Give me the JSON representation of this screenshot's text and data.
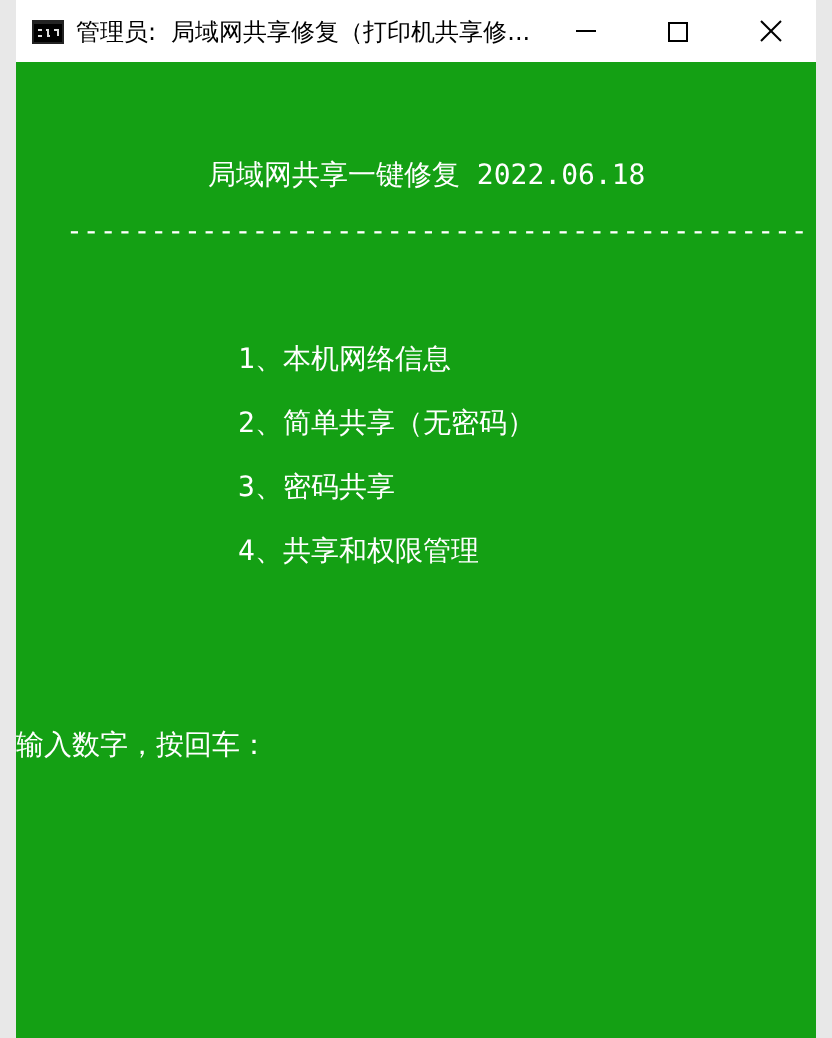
{
  "window": {
    "title": "管理员:  局域网共享修复（打印机共享修..."
  },
  "console": {
    "heading": "局域网共享一键修复 2022.06.18",
    "separator": "--------------------------------------------",
    "menu_items": [
      "1、本机网络信息",
      "2、简单共享（无密码）",
      "3、密码共享",
      "4、共享和权限管理"
    ],
    "prompt": "输入数字，按回车："
  }
}
